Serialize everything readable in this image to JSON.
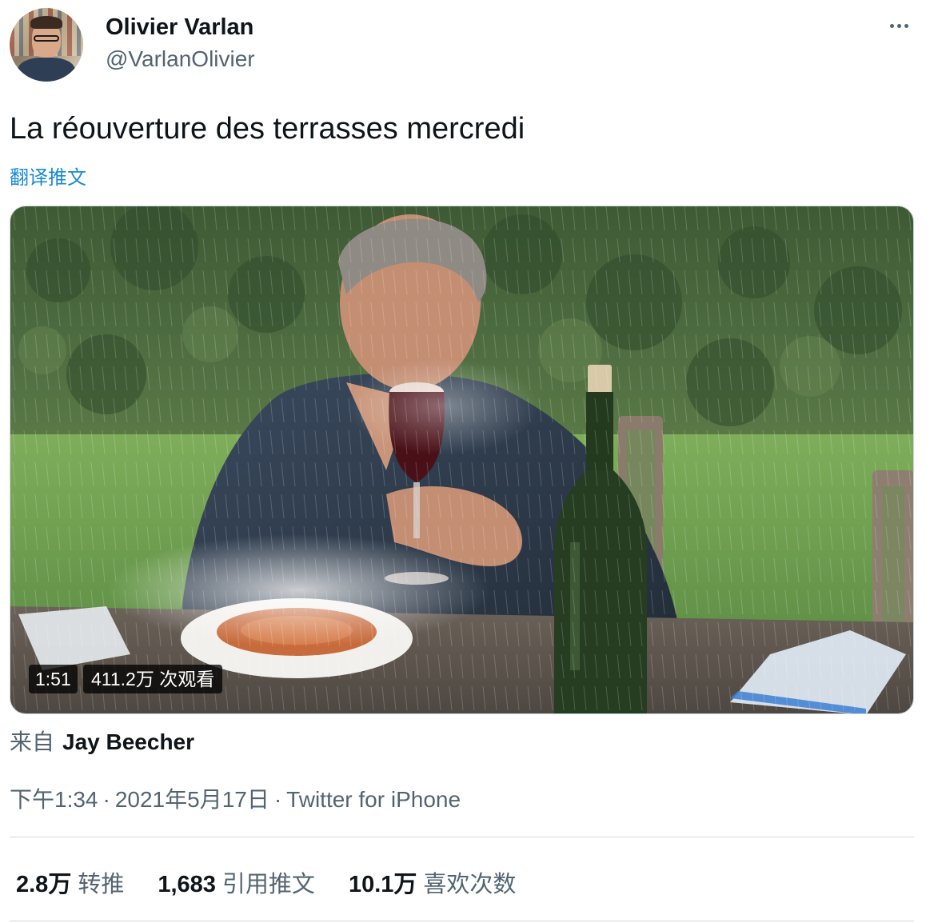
{
  "tweet": {
    "author": {
      "name": "Olivier Varlan",
      "handle": "@VarlanOlivier"
    },
    "text": "La réouverture des terrasses mercredi",
    "translate_label": "翻译推文",
    "video": {
      "duration": "1:51",
      "views": "411.2万 次观看"
    },
    "source": {
      "prefix": "来自",
      "author": "Jay Beecher"
    },
    "meta": {
      "time": "下午1:34",
      "date": "2021年5月17日",
      "separator": "·",
      "client": "Twitter for iPhone"
    },
    "stats": [
      {
        "value": "2.8万",
        "label": "转推"
      },
      {
        "value": "1,683",
        "label": "引用推文"
      },
      {
        "value": "10.1万",
        "label": "喜欢次数"
      }
    ]
  },
  "icons": {
    "more": "more-horizontal-icon"
  },
  "colors": {
    "primary_text": "#0f1419",
    "secondary_text": "#536471",
    "link": "#1b8ad3",
    "border": "#cfd9de"
  }
}
